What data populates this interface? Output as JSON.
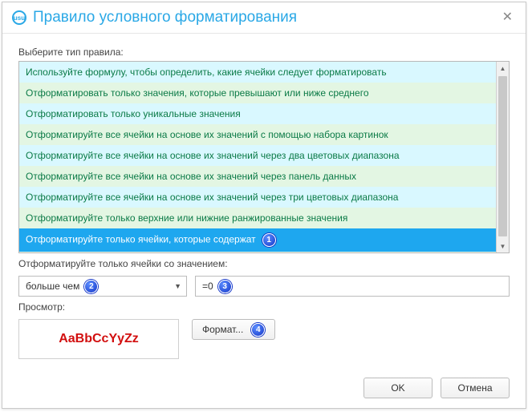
{
  "window": {
    "title": "Правило условного форматирования",
    "close_glyph": "✕",
    "icon_text": "usu"
  },
  "labels": {
    "rule_type": "Выберите тип правила:",
    "value_rule": "Отформатируйте только ячейки со значением:",
    "preview": "Просмотр:"
  },
  "rule_types": [
    "Используйте формулу, чтобы определить, какие ячейки следует форматировать",
    "Отформатировать только значения, которые превышают или ниже среднего",
    "Отформатировать только уникальные значения",
    "Отформатируйте все ячейки на основе их значений с помощью набора картинок",
    "Отформатируйте все ячейки на основе их значений через два цветовых диапазона",
    "Отформатируйте все ячейки на основе их значений через панель данных",
    "Отформатируйте все ячейки на основе их значений через три цветовых диапазона",
    "Отформатируйте только верхние или нижние ранжированные значения",
    "Отформатируйте только ячейки, которые содержат"
  ],
  "selected_index": 8,
  "condition": {
    "operator": "больше чем",
    "value": "=0"
  },
  "preview": {
    "sample_text": "AaBbCcYyZz",
    "sample_color": "#d20f0f"
  },
  "buttons": {
    "format": "Формат...",
    "ok": "OK",
    "cancel": "Отмена"
  },
  "callouts": {
    "c1": "1",
    "c2": "2",
    "c3": "3",
    "c4": "4"
  },
  "scroll": {
    "up": "▲",
    "down": "▼"
  }
}
